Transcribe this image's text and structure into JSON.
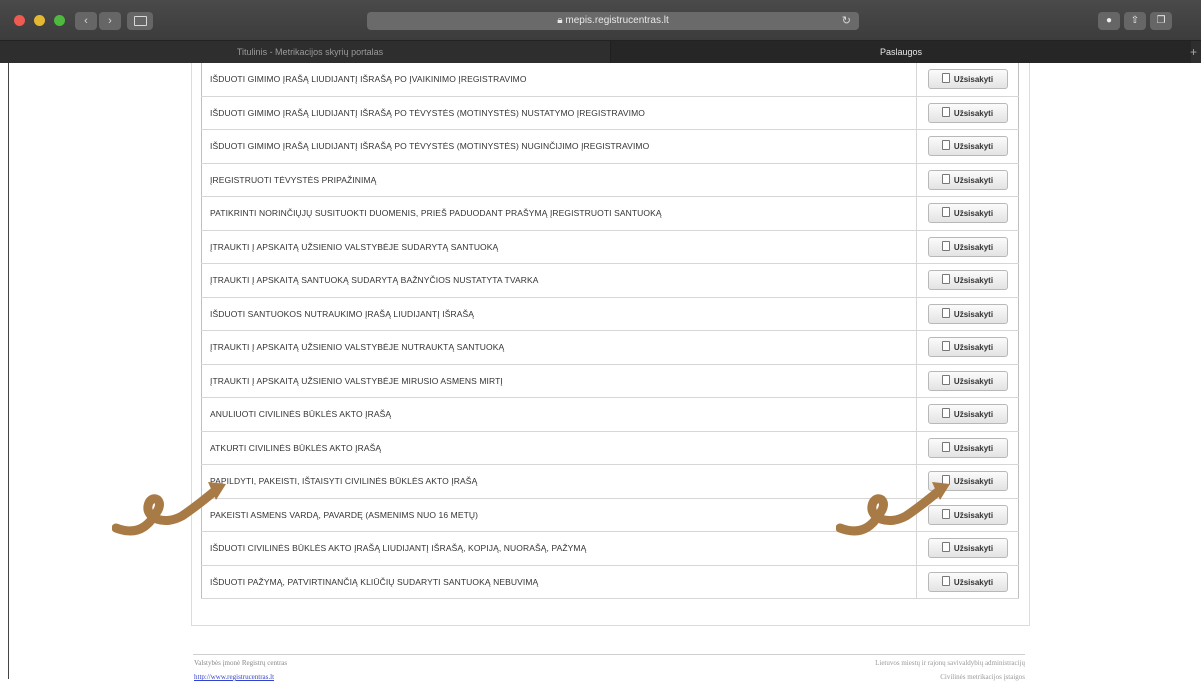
{
  "browser": {
    "url": "mepis.registrucentras.lt",
    "tabs": [
      {
        "label": "Titulinis - Metrikacijos skyrių portalas",
        "active": false
      },
      {
        "label": "Paslaugos",
        "active": true
      }
    ]
  },
  "services": [
    {
      "label": "IŠDUOTI GIMIMO ĮRAŠĄ LIUDIJANTĮ IŠRAŠĄ PO ĮVAIKINIMO ĮREGISTRAVIMO",
      "action": "Užsisakyti"
    },
    {
      "label": "IŠDUOTI GIMIMO ĮRAŠĄ LIUDIJANTĮ IŠRAŠĄ PO TĖVYSTĖS (MOTINYSTĖS) NUSTATYMO ĮREGISTRAVIMO",
      "action": "Užsisakyti"
    },
    {
      "label": "IŠDUOTI GIMIMO ĮRAŠĄ LIUDIJANTĮ IŠRAŠĄ PO TĖVYSTĖS (MOTINYSTĖS) NUGINČIJIMO ĮREGISTRAVIMO",
      "action": "Užsisakyti"
    },
    {
      "label": "ĮREGISTRUOTI TĖVYSTĖS PRIPAŽINIMĄ",
      "action": "Užsisakyti"
    },
    {
      "label": "PATIKRINTI NORINČIŲJŲ SUSITUOKTI DUOMENIS, PRIEŠ PADUODANT PRAŠYMĄ ĮREGISTRUOTI SANTUOKĄ",
      "action": "Užsisakyti"
    },
    {
      "label": "ĮTRAUKTI Į APSKAITĄ UŽSIENIO VALSTYBĖJE SUDARYTĄ SANTUOKĄ",
      "action": "Užsisakyti"
    },
    {
      "label": "ĮTRAUKTI Į APSKAITĄ SANTUOKĄ SUDARYTĄ BAŽNYČIOS NUSTATYTA TVARKA",
      "action": "Užsisakyti"
    },
    {
      "label": "IŠDUOTI SANTUOKOS NUTRAUKIMO ĮRAŠĄ LIUDIJANTĮ IŠRAŠĄ",
      "action": "Užsisakyti"
    },
    {
      "label": "ĮTRAUKTI Į APSKAITĄ UŽSIENIO VALSTYBĖJE NUTRAUKTĄ SANTUOKĄ",
      "action": "Užsisakyti"
    },
    {
      "label": "ĮTRAUKTI Į APSKAITĄ UŽSIENIO VALSTYBĖJE MIRUSIO ASMENS MIRTĮ",
      "action": "Užsisakyti"
    },
    {
      "label": "ANULIUOTI CIVILINĖS BŪKLĖS AKTO ĮRAŠĄ",
      "action": "Užsisakyti"
    },
    {
      "label": "ATKURTI CIVILINĖS BŪKLĖS AKTO ĮRAŠĄ",
      "action": "Užsisakyti"
    },
    {
      "label": "PAPILDYTI, PAKEISTI, IŠTAISYTI CIVILINĖS BŪKLĖS AKTO ĮRAŠĄ",
      "action": "Užsisakyti"
    },
    {
      "label": "PAKEISTI ASMENS VARDĄ, PAVARDĘ (ASMENIMS NUO 16 METŲ)",
      "action": "Užsisakyti"
    },
    {
      "label": "IŠDUOTI CIVILINĖS BŪKLĖS AKTO ĮRAŠĄ LIUDIJANTĮ IŠRAŠĄ, KOPIJĄ, NUORAŠĄ, PAŽYMĄ",
      "action": "Užsisakyti"
    },
    {
      "label": "IŠDUOTI PAŽYMĄ, PATVIRTINANČIĄ KLIŪČIŲ SUDARYTI SANTUOKĄ NEBUVIMĄ",
      "action": "Užsisakyti"
    }
  ],
  "footer": {
    "owner": "Valstybės įmonė Registrų centras",
    "link": "http://www.registrucentras.lt",
    "right_1": "Lietuvos miestų ir rajonų savivaldybių administracijų",
    "right_2": "Civilinės metrikacijos įstaigos"
  },
  "colors": {
    "annotation_arrow": "#a87a45",
    "link": "#3344cc"
  }
}
